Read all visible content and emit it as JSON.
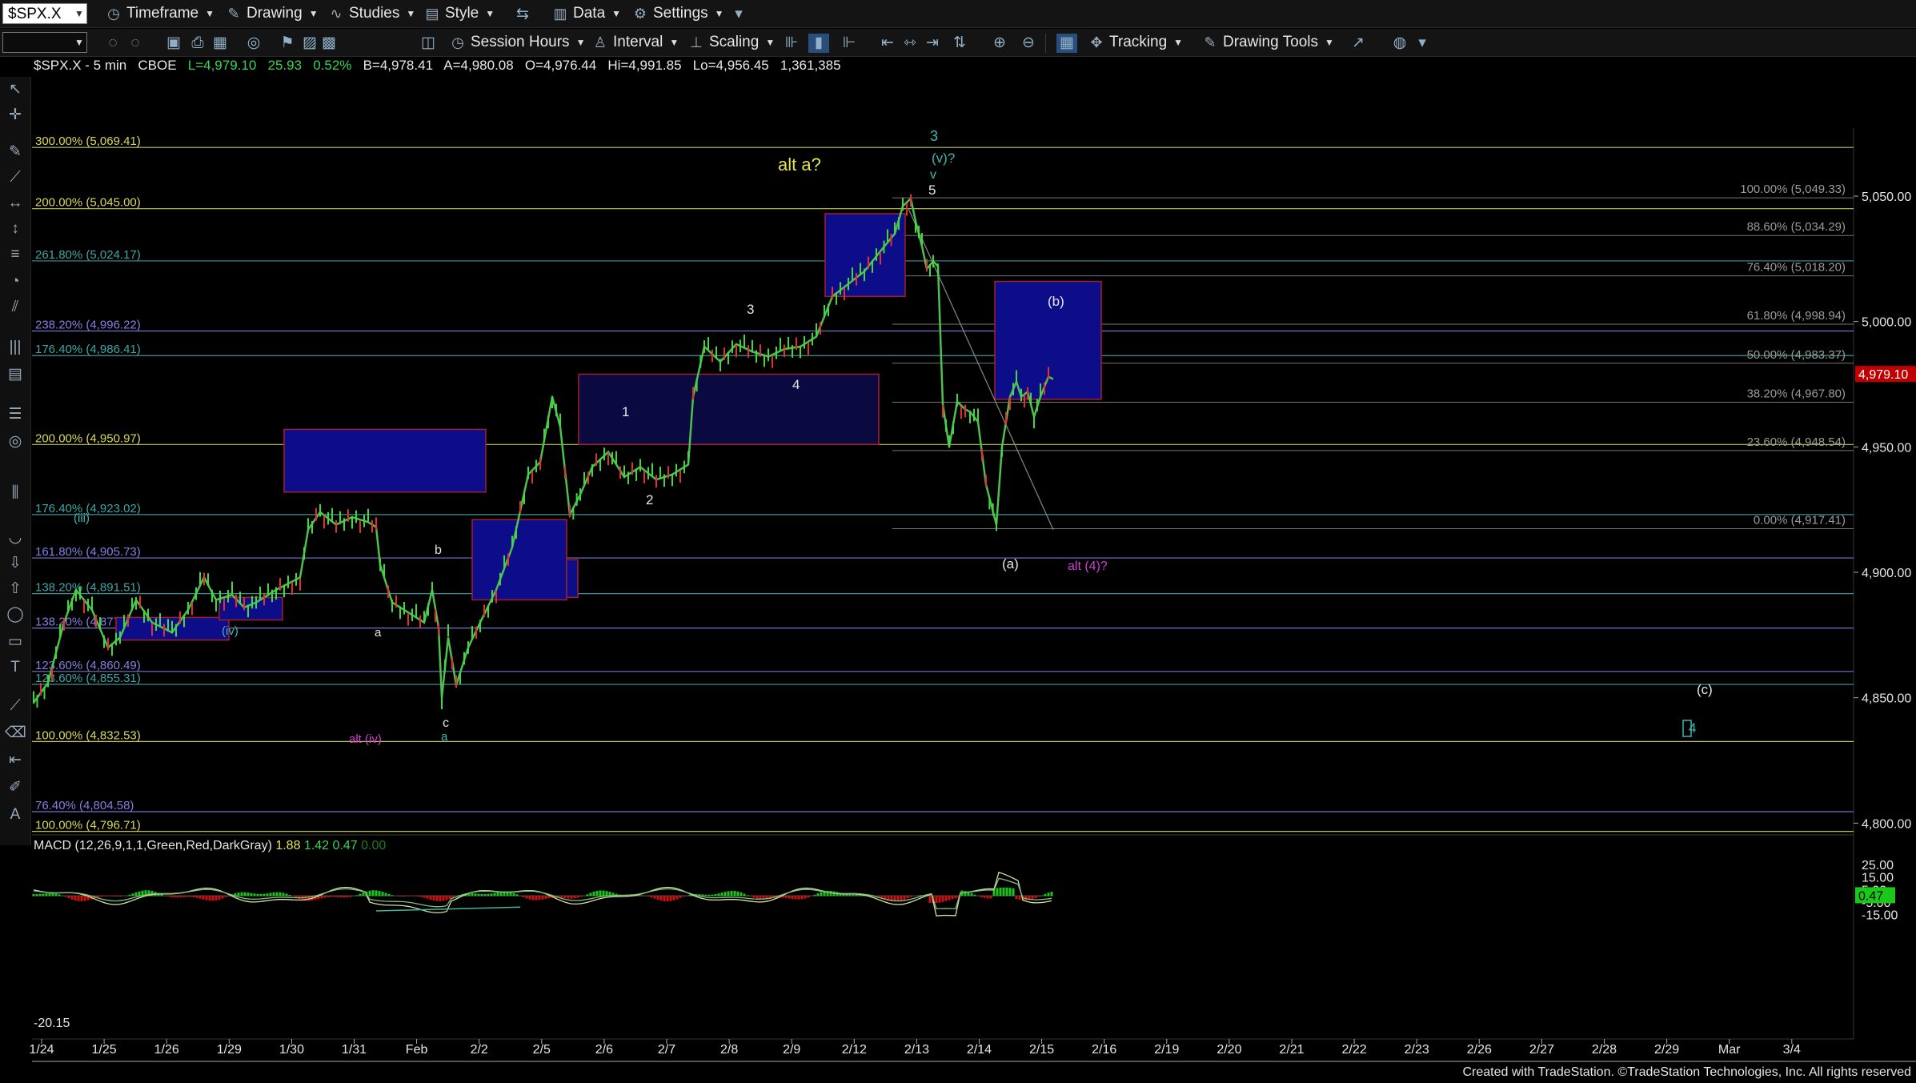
{
  "toolbar1": {
    "symbol": "$SPX.X",
    "timeframe": "Timeframe",
    "drawing": "Drawing",
    "studies": "Studies",
    "style": "Style",
    "data": "Data",
    "settings": "Settings"
  },
  "toolbar2": {
    "session_hours": "Session Hours",
    "interval": "Interval",
    "scaling": "Scaling",
    "tracking": "Tracking",
    "drawing_tools": "Drawing Tools"
  },
  "header": {
    "symbol_interval": "$SPX.X - 5 min",
    "exchange": "CBOE",
    "last": "L=4,979.10",
    "change": "25.93",
    "change_pct": "0.52%",
    "bid": "B=4,978.41",
    "ask": "A=4,980.08",
    "open": "O=4,976.44",
    "high": "Hi=4,991.85",
    "low": "Lo=4,956.45",
    "volume": "1,361,385"
  },
  "macd_header": {
    "label": "MACD (12,26,9,1,1,Green,Red,DarkGray)",
    "v1": "1.88",
    "v2": "1.42",
    "v3": "0.47",
    "v4": "0.00"
  },
  "price_axis": {
    "ticks": [
      {
        "value": 5050,
        "label": "5,050.00"
      },
      {
        "value": 5000,
        "label": "5,000.00"
      },
      {
        "value": 4950,
        "label": "4,950.00"
      },
      {
        "value": 4900,
        "label": "4,900.00"
      },
      {
        "value": 4850,
        "label": "4,850.00"
      },
      {
        "value": 4800,
        "label": "4,800.00"
      }
    ],
    "current": {
      "value": 4979.1,
      "label": "4,979.10",
      "color": "#c00000"
    }
  },
  "macd_axis": {
    "ticks": [
      {
        "value": 25,
        "label": "25.00"
      },
      {
        "value": 15,
        "label": "15.00"
      },
      {
        "value": 5,
        "label": "5.00"
      },
      {
        "value": -5,
        "label": "-5.00"
      },
      {
        "value": -15,
        "label": "-15.00"
      }
    ],
    "current": {
      "value": 0.47,
      "label": "0.47",
      "color": "#19c819"
    },
    "min_label": "-20.15"
  },
  "date_axis": [
    "1/24",
    "1/25",
    "1/26",
    "1/29",
    "1/30",
    "1/31",
    "Feb",
    "2/2",
    "2/5",
    "2/6",
    "2/7",
    "2/8",
    "2/9",
    "2/12",
    "2/13",
    "2/14",
    "2/15",
    "2/16",
    "2/19",
    "2/20",
    "2/21",
    "2/22",
    "2/23",
    "2/26",
    "2/27",
    "2/28",
    "2/29",
    "Mar",
    "3/4"
  ],
  "fib_left": [
    {
      "label": "300.00% (5,069.41)",
      "value": 5069.41,
      "color": "#d9d95a"
    },
    {
      "label": "200.00% (5,045.00)",
      "value": 5045.0,
      "color": "#d9d95a"
    },
    {
      "label": "261.80% (5,024.17)",
      "value": 5024.17,
      "color": "#3fa6a6"
    },
    {
      "label": "238.20% (4,996.22)",
      "value": 4996.22,
      "color": "#8080e0"
    },
    {
      "label": "176.40% (4,986.41)",
      "value": 4986.41,
      "color": "#3fa6a6"
    },
    {
      "label": "200.00% (4,950.97)",
      "value": 4950.97,
      "color": "#d9d95a"
    },
    {
      "label": "176.40% (4,923.02)",
      "value": 4923.02,
      "color": "#3fa6a6"
    },
    {
      "label": "161.80% (4,905.73)",
      "value": 4905.73,
      "color": "#8080e0"
    },
    {
      "label": "138.20% (4,891.51)",
      "value": 4891.51,
      "color": "#3fa6a6"
    },
    {
      "label": "138.20% (4,877.78)",
      "value": 4877.78,
      "color": "#8080e0"
    },
    {
      "label": "123.60% (4,860.49)",
      "value": 4860.49,
      "color": "#8080e0"
    },
    {
      "label": "123.60% (4,855.31)",
      "value": 4855.31,
      "color": "#3fa6a6"
    },
    {
      "label": "100.00% (4,832.53)",
      "value": 4832.53,
      "color": "#d9d95a"
    },
    {
      "label": "76.40% (4,804.58)",
      "value": 4804.58,
      "color": "#8080e0"
    },
    {
      "label": "100.00% (4,796.71)",
      "value": 4796.71,
      "color": "#d9d95a"
    }
  ],
  "fib_right": [
    {
      "label": "100.00% (5,049.33)",
      "value": 5049.33
    },
    {
      "label": "88.60% (5,034.29)",
      "value": 5034.29
    },
    {
      "label": "76.40% (5,018.20)",
      "value": 5018.2
    },
    {
      "label": "61.80% (4,998.94)",
      "value": 4998.94
    },
    {
      "label": "50.00% (4,983.37)",
      "value": 4983.37
    },
    {
      "label": "38.20% (4,967.80)",
      "value": 4967.8
    },
    {
      "label": "23.60% (4,948.54)",
      "value": 4948.54
    },
    {
      "label": "0.00% (4,917.41)",
      "value": 4917.41
    }
  ],
  "annotations": [
    {
      "text": "alt a?",
      "color": "#e6e64a"
    },
    {
      "text": "3",
      "color": "#3fb6b6"
    },
    {
      "text": "(v)?",
      "color": "#3fb6b6"
    },
    {
      "text": "v",
      "color": "#3fb6b6"
    },
    {
      "text": "5",
      "color": "#e6e6e6"
    },
    {
      "text": "3",
      "color": "#e6e6e6"
    },
    {
      "text": "4",
      "color": "#e6e6e6"
    },
    {
      "text": "1",
      "color": "#e6e6e6"
    },
    {
      "text": "2",
      "color": "#e6e6e6"
    },
    {
      "text": "(b)",
      "color": "#e6e6e6"
    },
    {
      "text": "(a)",
      "color": "#e6e6e6"
    },
    {
      "text": "alt (4)?",
      "color": "#d040d0"
    },
    {
      "text": "b",
      "color": "#e6e6e6"
    },
    {
      "text": "a",
      "color": "#e6e6e6"
    },
    {
      "text": "c",
      "color": "#e6e6e6"
    },
    {
      "text": "a",
      "color": "#3fb6b6"
    },
    {
      "text": "alt (iv)",
      "color": "#d040d0"
    },
    {
      "text": "(iii)",
      "color": "#3fb6b6"
    },
    {
      "text": "(iv)",
      "color": "#3fb6b6"
    },
    {
      "text": "(c)",
      "color": "#e6e6e6"
    },
    {
      "text": "4",
      "color": "#3fb6b6"
    }
  ],
  "footer": "Created with TradeStation. ©TradeStation Technologies, Inc. All rights reserved"
}
